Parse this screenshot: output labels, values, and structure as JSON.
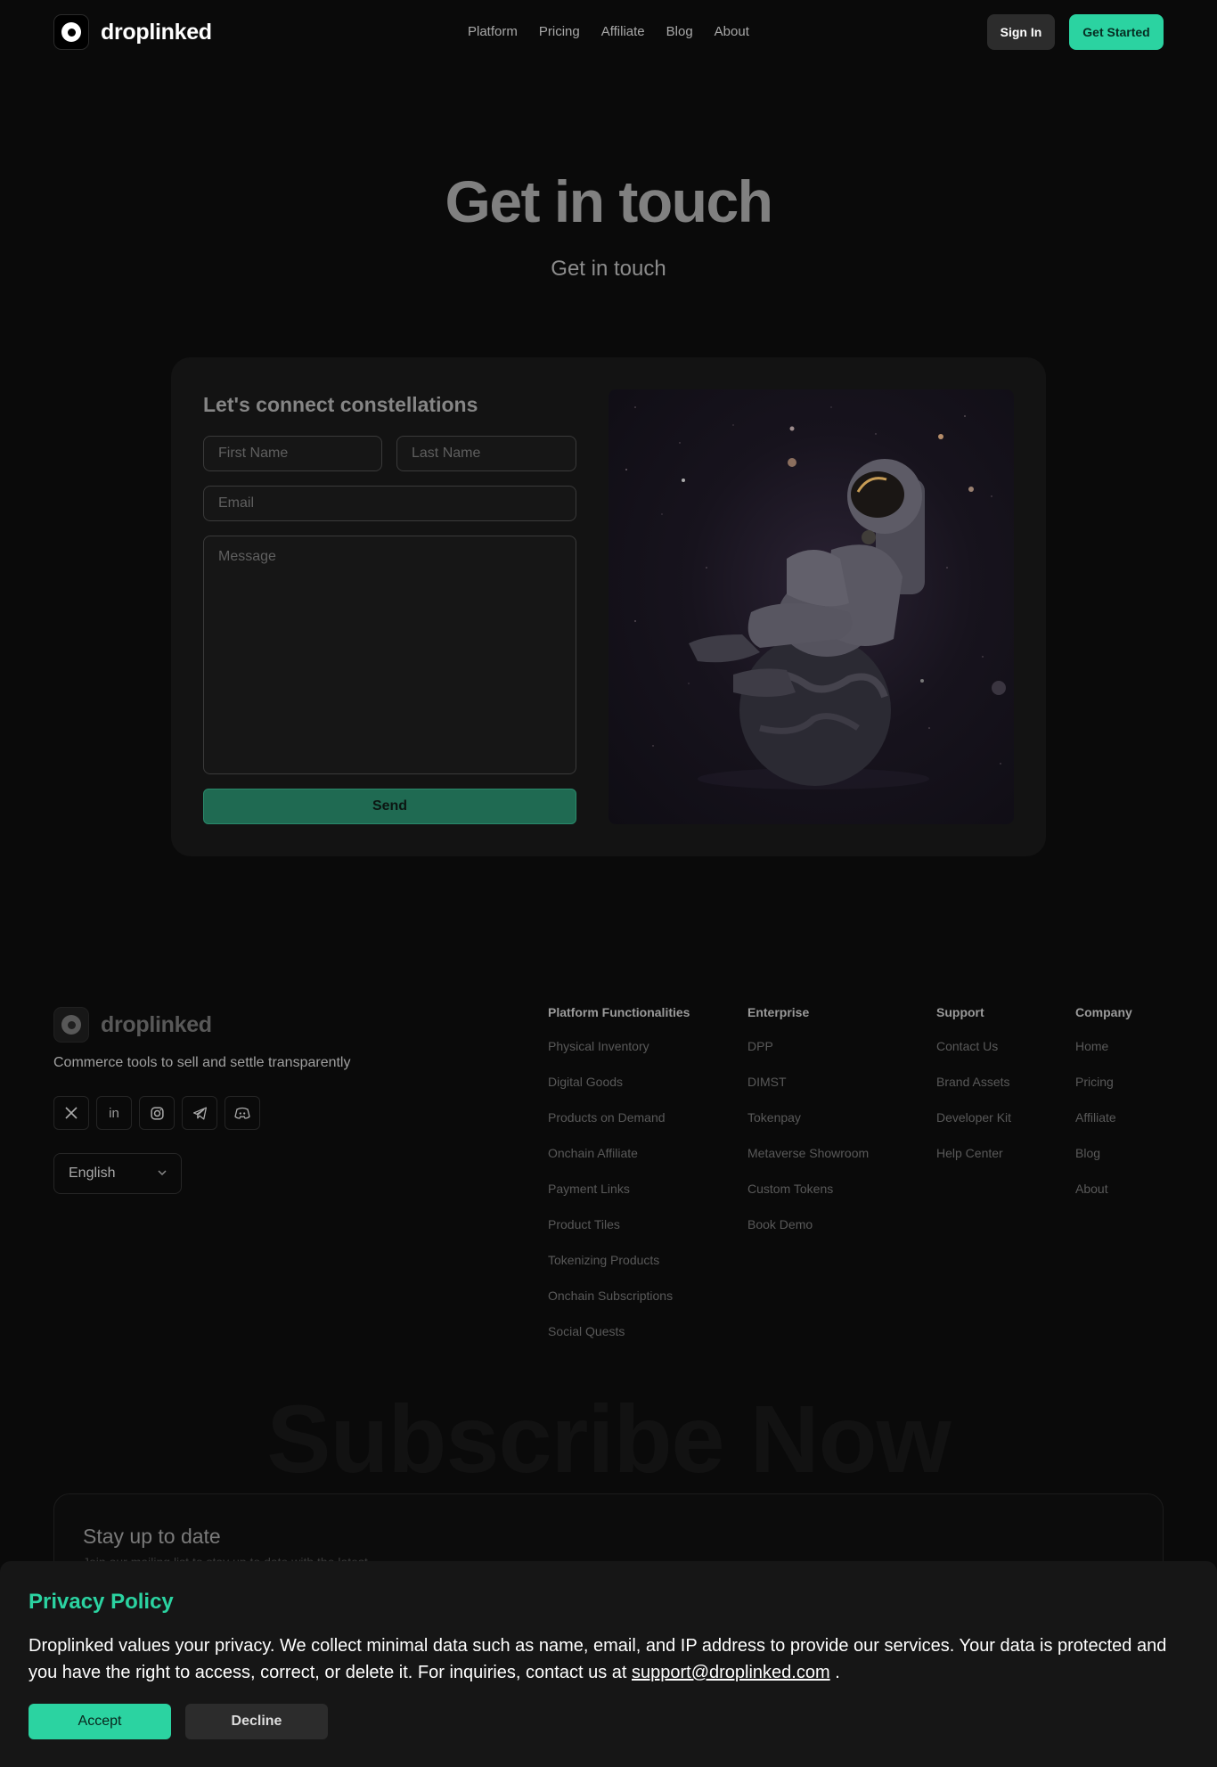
{
  "nav": {
    "brand": "droplinked",
    "links": [
      "Platform",
      "Pricing",
      "Affiliate",
      "Blog",
      "About"
    ],
    "sign_in": "Sign In",
    "get_started": "Get Started"
  },
  "hero": {
    "title": "Get in touch",
    "subtitle": "Get in touch"
  },
  "contact": {
    "title": "Let's connect constellations",
    "first_name_placeholder": "First Name",
    "last_name_placeholder": "Last Name",
    "email_placeholder": "Email",
    "message_placeholder": "Message",
    "send": "Send"
  },
  "footer": {
    "brand": "droplinked",
    "tagline": "Commerce tools to sell and settle transparently",
    "socials": [
      "x-icon",
      "linkedin-icon",
      "instagram-icon",
      "telegram-icon",
      "discord-icon"
    ],
    "language": "English",
    "columns": [
      {
        "title": "Platform Functionalities",
        "links": [
          "Physical Inventory",
          "Digital Goods",
          "Products on Demand",
          "Onchain Affiliate",
          "Payment Links",
          "Product Tiles",
          "Tokenizing Products",
          "Onchain Subscriptions",
          "Social Quests"
        ]
      },
      {
        "title": "Enterprise",
        "links": [
          "DPP",
          "DIMST",
          "Tokenpay",
          "Metaverse Showroom",
          "Custom Tokens",
          "Book Demo"
        ]
      },
      {
        "title": "Support",
        "links": [
          "Contact Us",
          "Brand Assets",
          "Developer Kit",
          "Help Center"
        ]
      },
      {
        "title": "Company",
        "links": [
          "Home",
          "Pricing",
          "Affiliate",
          "Blog",
          "About"
        ]
      }
    ]
  },
  "subscribe": {
    "big_text": "Subscribe Now",
    "title": "Stay up to date",
    "desc": "Join our mailing list to stay up to date with the latest"
  },
  "privacy": {
    "title": "Privacy Policy",
    "text": "Droplinked values your privacy. We collect minimal data such as name, email, and IP address to provide our services. Your data is protected and you have the right to access, correct, or delete it. For inquiries, contact us at ",
    "email": "support@droplinked.com",
    "text_end": " .",
    "accept": "Accept",
    "decline": "Decline"
  },
  "colors": {
    "accent": "#2bd3a1",
    "background": "#0a0a0a",
    "card": "#131313"
  }
}
